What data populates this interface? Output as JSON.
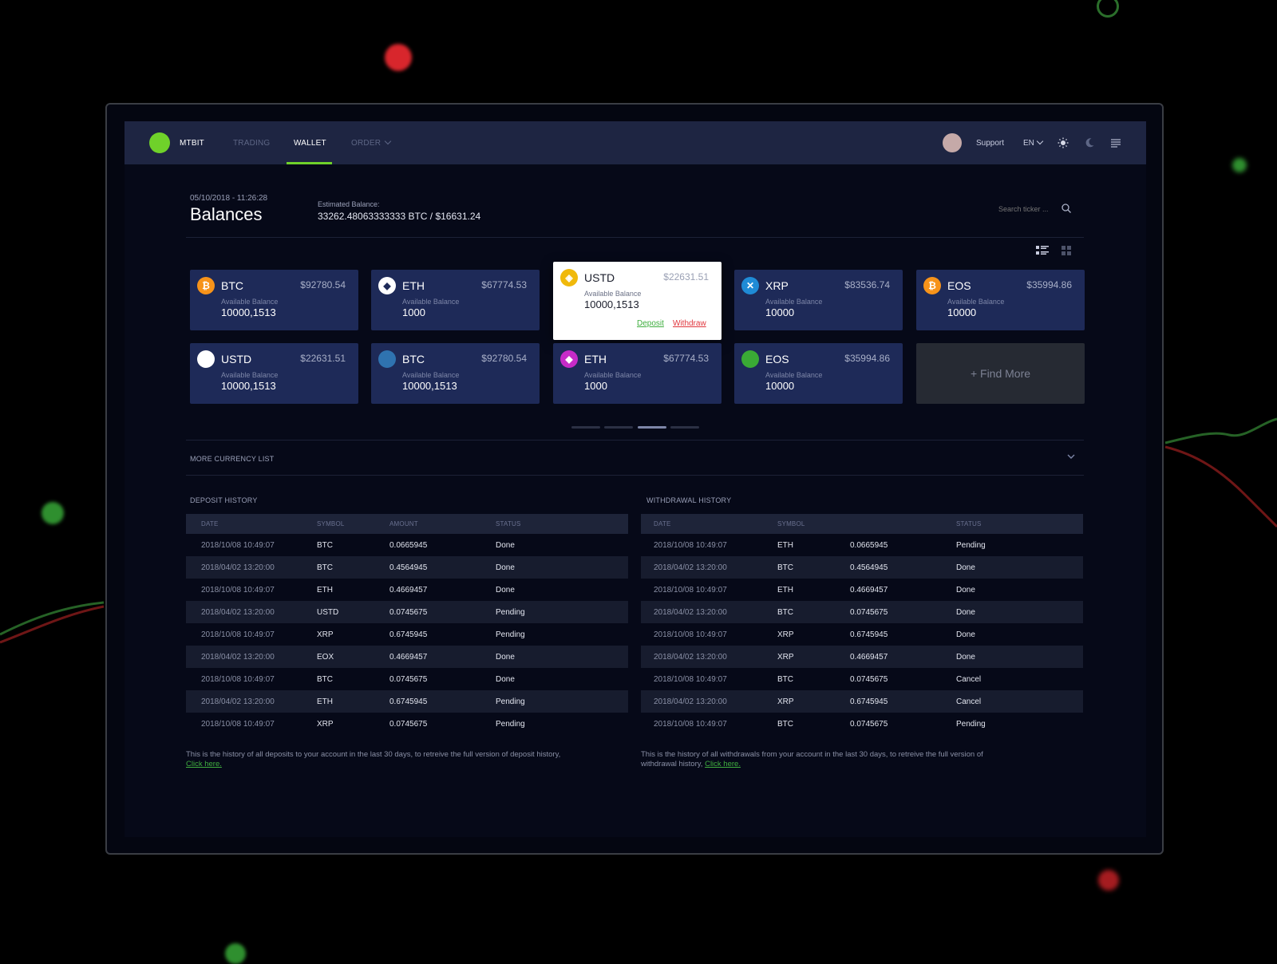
{
  "brand": "MTBIT",
  "nav": {
    "trading": "TRADING",
    "wallet": "WALLET",
    "order": "ORDER"
  },
  "topbar": {
    "support": "Support",
    "lang": "EN"
  },
  "header": {
    "datetime": "05/10/2018 - 11:26:28",
    "title": "Balances",
    "est_label": "Estimated Balance:",
    "est_value": "33262.48063333333 BTC / $16631.24",
    "search_placeholder": "Search ticker ..."
  },
  "cards": [
    {
      "symbol": "BTC",
      "price": "$92780.54",
      "label": "Available Balance",
      "balance": "10000,1513",
      "icon": "bitcoin-icon",
      "icon_color": "#f7931a"
    },
    {
      "symbol": "ETH",
      "price": "$67774.53",
      "label": "Available Balance",
      "balance": "1000",
      "icon": "ethereum-icon",
      "icon_color": "#ffffff"
    },
    {
      "symbol": "USTD",
      "price": "$22631.51",
      "label": "Available Balance",
      "balance": "10000,1513",
      "icon": "binance-icon",
      "icon_color": "#f0b90b",
      "deposit": "Deposit",
      "withdraw": "Withdraw"
    },
    {
      "symbol": "XRP",
      "price": "$83536.74",
      "label": "Available Balance",
      "balance": "10000",
      "icon": "ripple-icon",
      "icon_color": "#1f8bd6"
    },
    {
      "symbol": "EOS",
      "price": "$35994.86",
      "label": "Available Balance",
      "balance": "10000",
      "icon": "bitcoin-icon",
      "icon_color": "#f7931a"
    },
    {
      "symbol": "USTD",
      "price": "$22631.51",
      "label": "Available Balance",
      "balance": "10000,1513",
      "icon": "circle-icon",
      "icon_color": "#ffffff"
    },
    {
      "symbol": "BTC",
      "price": "$92780.54",
      "label": "Available Balance",
      "balance": "10000,1513",
      "icon": "circle-icon",
      "icon_color": "#2f73b0"
    },
    {
      "symbol": "ETH",
      "price": "$67774.53",
      "label": "Available Balance",
      "balance": "1000",
      "icon": "ethereum-icon",
      "icon_color": "#c62bc8"
    },
    {
      "symbol": "EOS",
      "price": "$35994.86",
      "label": "Available Balance",
      "balance": "10000",
      "icon": "circle-icon",
      "icon_color": "#3aaa35"
    }
  ],
  "find_more": "+ Find More",
  "more_currency": "MORE CURRENCY LIST",
  "deposit": {
    "title": "DEPOSIT HISTORY",
    "headers": [
      "DATE",
      "SYMBOL",
      "AMOUNT",
      "STATUS"
    ],
    "rows": [
      [
        "2018/10/08 10:49:07",
        "BTC",
        "0.0665945",
        "Done"
      ],
      [
        "2018/04/02 13:20:00",
        "BTC",
        "0.4564945",
        "Done"
      ],
      [
        "2018/10/08 10:49:07",
        "ETH",
        "0.4669457",
        "Done"
      ],
      [
        "2018/04/02 13:20:00",
        "USTD",
        "0.0745675",
        "Pending"
      ],
      [
        "2018/10/08 10:49:07",
        "XRP",
        "0.6745945",
        "Pending"
      ],
      [
        "2018/04/02 13:20:00",
        "EOX",
        "0.4669457",
        "Done"
      ],
      [
        "2018/10/08 10:49:07",
        "BTC",
        "0.0745675",
        "Done"
      ],
      [
        "2018/04/02 13:20:00",
        "ETH",
        "0.6745945",
        "Pending"
      ],
      [
        "2018/10/08 10:49:07",
        "XRP",
        "0.0745675",
        "Pending"
      ]
    ],
    "footnote": "This is the history of all deposits to your account in the last 30 days, to retreive the full version of deposit history,",
    "link": "Click here."
  },
  "withdrawal": {
    "title": "WITHDRAWAL HISTORY",
    "headers": [
      "DATE",
      "SYMBOL",
      "",
      "STATUS"
    ],
    "rows": [
      [
        "2018/10/08 10:49:07",
        "ETH",
        "0.0665945",
        "Pending"
      ],
      [
        "2018/04/02 13:20:00",
        "BTC",
        "0.4564945",
        "Done"
      ],
      [
        "2018/10/08 10:49:07",
        "ETH",
        "0.4669457",
        "Done"
      ],
      [
        "2018/04/02 13:20:00",
        "BTC",
        "0.0745675",
        "Done"
      ],
      [
        "2018/10/08 10:49:07",
        "XRP",
        "0.6745945",
        "Done"
      ],
      [
        "2018/04/02 13:20:00",
        "XRP",
        "0.4669457",
        "Done"
      ],
      [
        "2018/10/08 10:49:07",
        "BTC",
        "0.0745675",
        "Cancel"
      ],
      [
        "2018/04/02 13:20:00",
        "XRP",
        "0.6745945",
        "Cancel"
      ],
      [
        "2018/10/08 10:49:07",
        "BTC",
        "0.0745675",
        "Pending"
      ]
    ],
    "footnote": "This is the history of all withdrawals from your account in the last 30 days, to retreive the full version of withdrawal history,",
    "link": "Click here."
  },
  "colors": {
    "accent": "#6fd12a",
    "card_bg": "#1e2a58",
    "topbar": "#1e2542",
    "deposit_link": "#3fae3f",
    "withdraw_link": "#e0353c"
  }
}
